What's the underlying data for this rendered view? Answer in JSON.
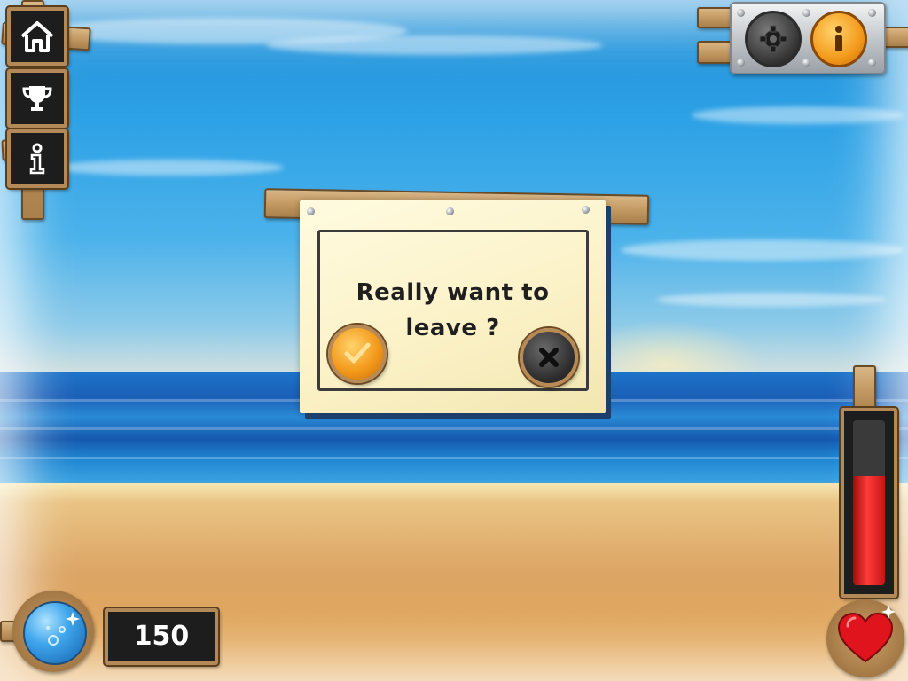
{
  "dialog": {
    "line1": "Really want to",
    "line2": "leave ?",
    "confirm_icon": "check-icon",
    "cancel_icon": "close-icon"
  },
  "left_menu": {
    "items": [
      {
        "name": "home",
        "icon": "home-icon"
      },
      {
        "name": "trophy",
        "icon": "trophy-icon"
      },
      {
        "name": "info",
        "icon": "info-icon"
      }
    ]
  },
  "top_right": {
    "settings_icon": "gear-icon",
    "info_icon": "info-icon"
  },
  "hud": {
    "score": "150",
    "orb_icon": "bubble-orb-icon",
    "health_fraction": 0.66,
    "heart_icon": "heart-icon"
  },
  "colors": {
    "confirm": "#f39a1c",
    "cancel": "#3a3a3a",
    "health": "#e21b1b",
    "orb": "#3fa6ec"
  }
}
